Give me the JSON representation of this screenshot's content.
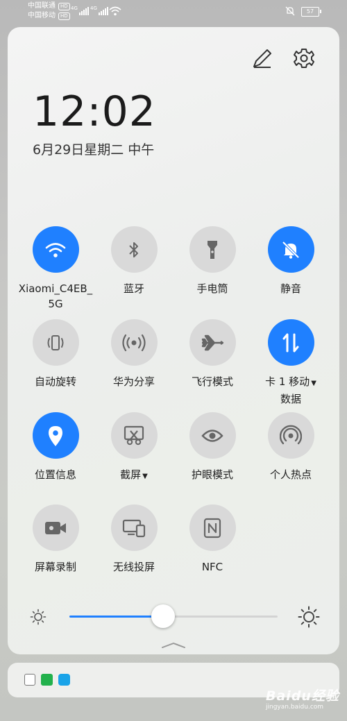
{
  "status_bar": {
    "carrier_1": "中国联通",
    "carrier_2": "中国移动",
    "hd_badge": "HD",
    "network_1": "4G",
    "network_2": "4G",
    "battery_level": "57"
  },
  "header": {
    "time": "12:02",
    "date": "6月29日星期二 中午",
    "edit_icon": "pencil-icon",
    "settings_icon": "gear-icon"
  },
  "tiles": [
    {
      "label": "Xiaomi_C4EB_\n5G",
      "icon": "wifi-icon",
      "active": true
    },
    {
      "label": "蓝牙",
      "icon": "bluetooth-icon",
      "active": false
    },
    {
      "label": "手电筒",
      "icon": "flashlight-icon",
      "active": false
    },
    {
      "label": "静音",
      "icon": "bell-off-icon",
      "active": true
    },
    {
      "label": "自动旋转",
      "icon": "auto-rotate-icon",
      "active": false
    },
    {
      "label": "华为分享",
      "icon": "share-icon",
      "active": false
    },
    {
      "label": "飞行模式",
      "icon": "airplane-icon",
      "active": false
    },
    {
      "label": "卡 1 移动",
      "label_line2": "数据",
      "icon": "mobile-data-icon",
      "active": true
    },
    {
      "label": "位置信息",
      "icon": "location-icon",
      "active": true
    },
    {
      "label": "截屏",
      "icon": "screenshot-icon",
      "active": false
    },
    {
      "label": "护眼模式",
      "icon": "eye-icon",
      "active": false
    },
    {
      "label": "个人热点",
      "icon": "hotspot-icon",
      "active": false
    },
    {
      "label": "屏幕录制",
      "icon": "screen-record-icon",
      "active": false
    },
    {
      "label": "无线投屏",
      "icon": "wireless-projection-icon",
      "active": false
    },
    {
      "label": "NFC",
      "icon": "nfc-icon",
      "active": false
    }
  ],
  "brightness": {
    "level": 0.45
  },
  "notifications": {
    "icons": [
      "file-icon",
      "iqiyi-icon",
      "lightbulb-icon"
    ],
    "colors": [
      "#777777",
      "#22b14c",
      "#1aa3e8"
    ]
  },
  "watermark": {
    "brand": "Baidu经验",
    "site": "jingyan.baidu.com"
  },
  "colors": {
    "accent": "#1f80ff",
    "tile_off": "#d9d9d9"
  }
}
